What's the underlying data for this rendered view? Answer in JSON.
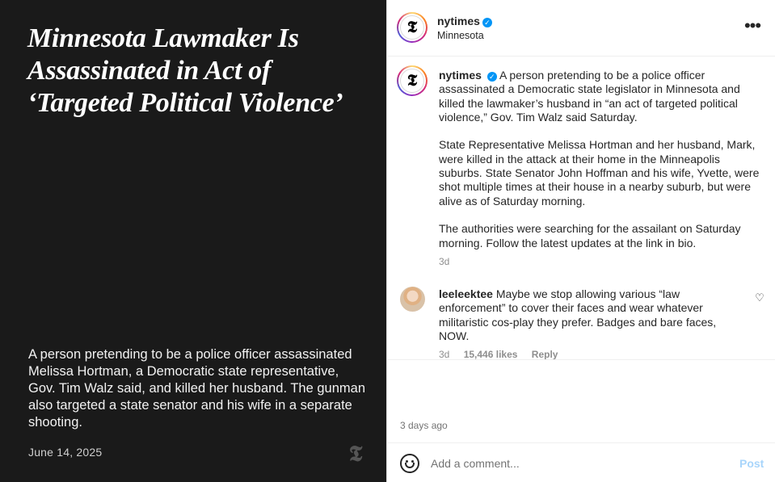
{
  "post_image": {
    "headline": "Minnesota Lawmaker Is Assassinated in Act of ‘Targeted Political Violence’",
    "summary": "A person pretending to be a police officer assassinated Melissa Hortman, a Democratic state representative, Gov. Tim Walz said, and killed her husband. The gunman also targeted a state senator and his wife in a separate shooting.",
    "date": "June 14, 2025",
    "logo_glyph": "𝕿"
  },
  "header": {
    "username": "nytimes",
    "location": "Minnesota",
    "more_label": "•••",
    "avatar_glyph": "𝕿"
  },
  "caption": {
    "username": "nytimes",
    "paragraphs": [
      "A person pretending to be a police officer assassinated a Democratic state legislator in Minnesota and killed the lawmaker’s husband in “an act of targeted political violence,” Gov. Tim Walz said Saturday.",
      "State Representative Melissa Hortman and her husband, Mark, were killed in the attack at their home in the Minneapolis suburbs. State Senator John Hoffman and his wife, Yvette, were shot multiple times at their house in a nearby suburb, but were alive as of Saturday morning.",
      "The authorities were searching for the assailant on Saturday morning. Follow the latest updates at the link in bio."
    ],
    "age": "3d"
  },
  "comment": {
    "username": "leeleektee",
    "text": "Maybe we stop allowing various “law enforcement” to cover their faces and wear whatever militaristic cos-play they prefer. Badges and bare faces, NOW.",
    "age": "3d",
    "likes": "15,446 likes",
    "reply_label": "Reply"
  },
  "footer": {
    "post_age": "3 days ago",
    "comment_placeholder": "Add a comment...",
    "post_label": "Post"
  },
  "colors": {
    "image_background": "#1a1a1a",
    "verified_badge": "#0095f6",
    "post_button_disabled": "#a8d5fb"
  }
}
